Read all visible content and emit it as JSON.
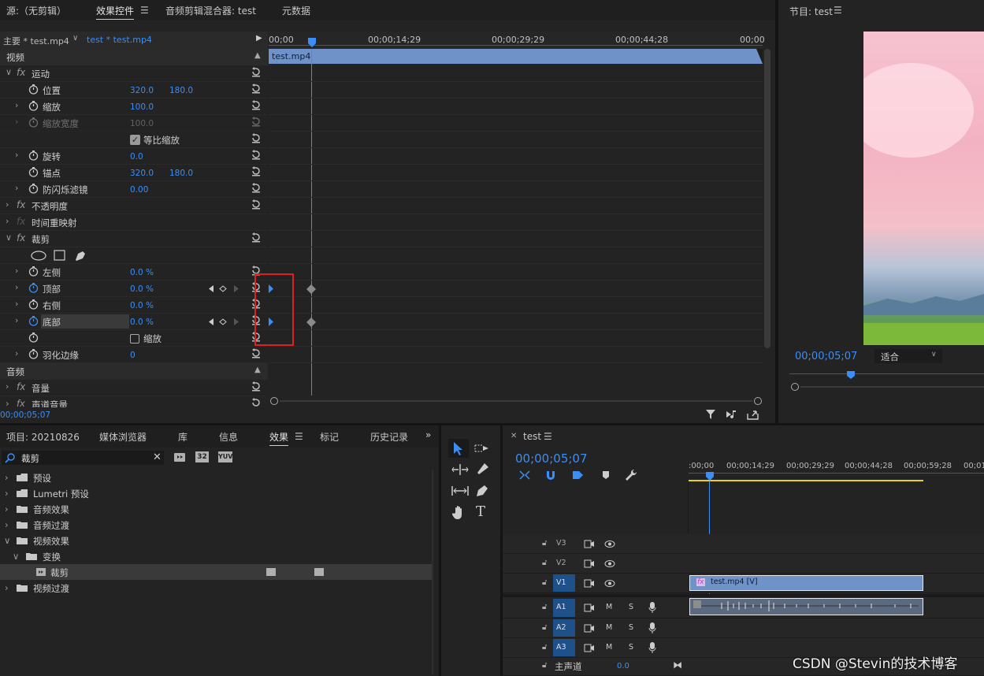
{
  "effect_controls": {
    "tabs": {
      "source": "源:（无剪辑）",
      "effect_controls": "效果控件",
      "audio_mixer": "音频剪辑混合器: test",
      "metadata": "元数据"
    },
    "clip_bar": {
      "master": "主要 * test.mp4",
      "clip": "test * test.mp4"
    },
    "ruler": [
      "00;00",
      "00;00;14;29",
      "00;00;29;29",
      "00;00;44;28",
      "00;00"
    ],
    "clip_name": "test.mp4",
    "section_video": "视频",
    "section_audio": "音频",
    "motion": {
      "label": "运动",
      "position": "位置",
      "pos_x": "320.0",
      "pos_y": "180.0",
      "scale": "缩放",
      "scale_val": "100.0",
      "scale_width": "缩放宽度",
      "scale_width_val": "100.0",
      "uniform": "等比缩放",
      "rotation": "旋转",
      "rotation_val": "0.0",
      "anchor": "锚点",
      "anchor_x": "320.0",
      "anchor_y": "180.0",
      "flicker": "防闪烁滤镜",
      "flicker_val": "0.00"
    },
    "opacity": "不透明度",
    "time_remap": "时间重映射",
    "crop": {
      "label": "裁剪",
      "left": "左侧",
      "left_val": "0.0 %",
      "top": "顶部",
      "top_val": "0.0 %",
      "right": "右侧",
      "right_val": "0.0 %",
      "bottom": "底部",
      "bottom_val": "0.0 %",
      "zoom": "缩放",
      "feather": "羽化边缘",
      "feather_val": "0"
    },
    "audio": {
      "volume": "音量",
      "channel_volume": "声道音量"
    },
    "timecode": "00;00;05;07"
  },
  "program": {
    "title": "节目: test",
    "timecode": "00;00;05;07",
    "fit": "适合"
  },
  "project": {
    "tabs": {
      "project": "项目: 20210826",
      "media_browser": "媒体浏览器",
      "library": "库",
      "info": "信息",
      "effects": "效果",
      "markers": "标记",
      "history": "历史记录"
    },
    "search_value": "裁剪",
    "badges": [
      "32",
      "YUV"
    ],
    "tree": {
      "presets": "预设",
      "lumetri": "Lumetri 预设",
      "audio_effects": "音频效果",
      "audio_transitions": "音频过渡",
      "video_effects": "视频效果",
      "transform": "变换",
      "crop": "裁剪",
      "video_transitions": "视频过渡"
    }
  },
  "sequence": {
    "name": "test",
    "timecode": "00;00;05;07",
    "ruler": [
      ":00;00",
      "00;00;14;29",
      "00;00;29;29",
      "00;00;44;28",
      "00;00;59;28",
      "00;01"
    ],
    "tracks": {
      "v3": "V3",
      "v2": "V2",
      "v1": "V1",
      "a1": "A1",
      "a2": "A2",
      "a3": "A3"
    },
    "mute": "M",
    "solo": "S",
    "video_clip": "test.mp4 [V]",
    "master": "主声道",
    "master_val": "0.0"
  },
  "watermark": "CSDN @Stevin的技术博客",
  "colors": {
    "accent": "#3b8ef5",
    "clip_blue": "#6f93c8",
    "annotation_red": "#e02020",
    "work_area": "#e8d21a"
  }
}
